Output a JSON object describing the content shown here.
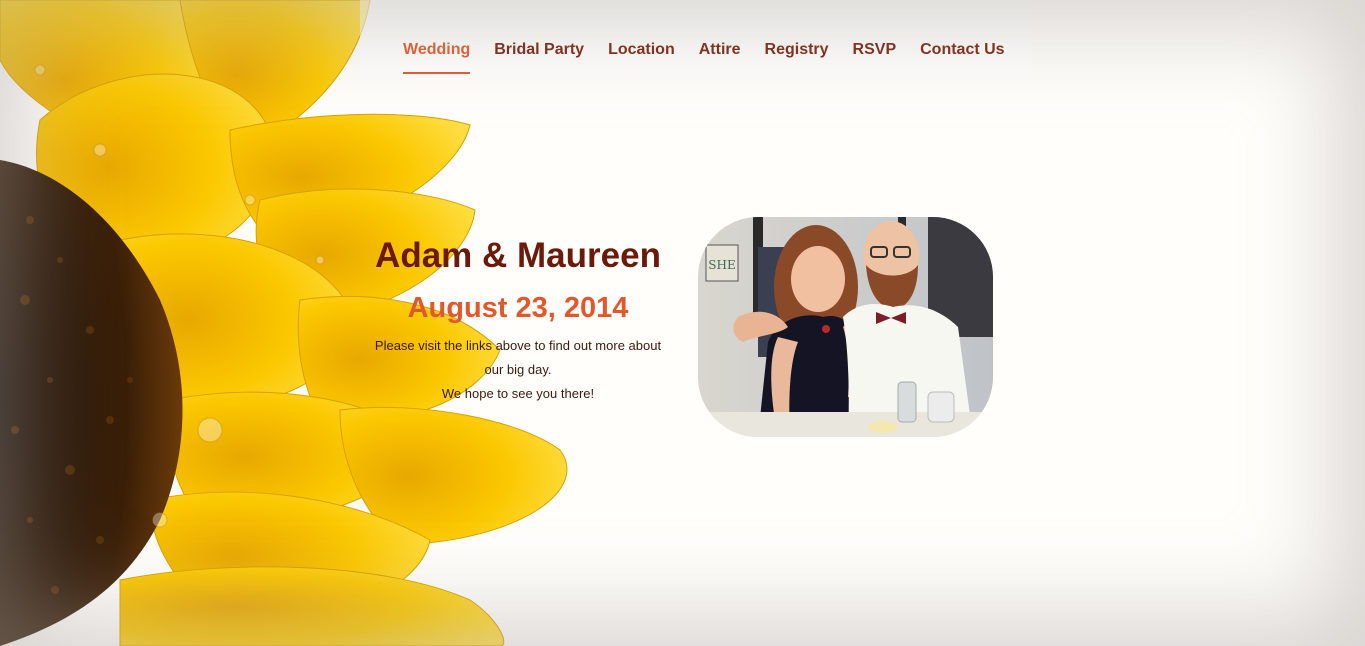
{
  "nav": {
    "items": [
      {
        "label": "Wedding",
        "active": true
      },
      {
        "label": "Bridal Party",
        "active": false
      },
      {
        "label": "Location",
        "active": false
      },
      {
        "label": "Attire",
        "active": false
      },
      {
        "label": "Registry",
        "active": false
      },
      {
        "label": "RSVP",
        "active": false
      },
      {
        "label": "Contact Us",
        "active": false
      }
    ]
  },
  "hero": {
    "names": "Adam & Maureen",
    "date": "August 23, 2014",
    "message_line1": "Please visit the links above to find out more about",
    "message_line2": "our big day.",
    "message_line3": "We hope to see you there!"
  },
  "photo": {
    "sign_text": "SHE"
  },
  "colors": {
    "accent": "#e2582a",
    "nav_text": "#7a1f0c",
    "name_text": "#6b1a0a",
    "petal": "#f7c300",
    "background": "#fffefb"
  }
}
